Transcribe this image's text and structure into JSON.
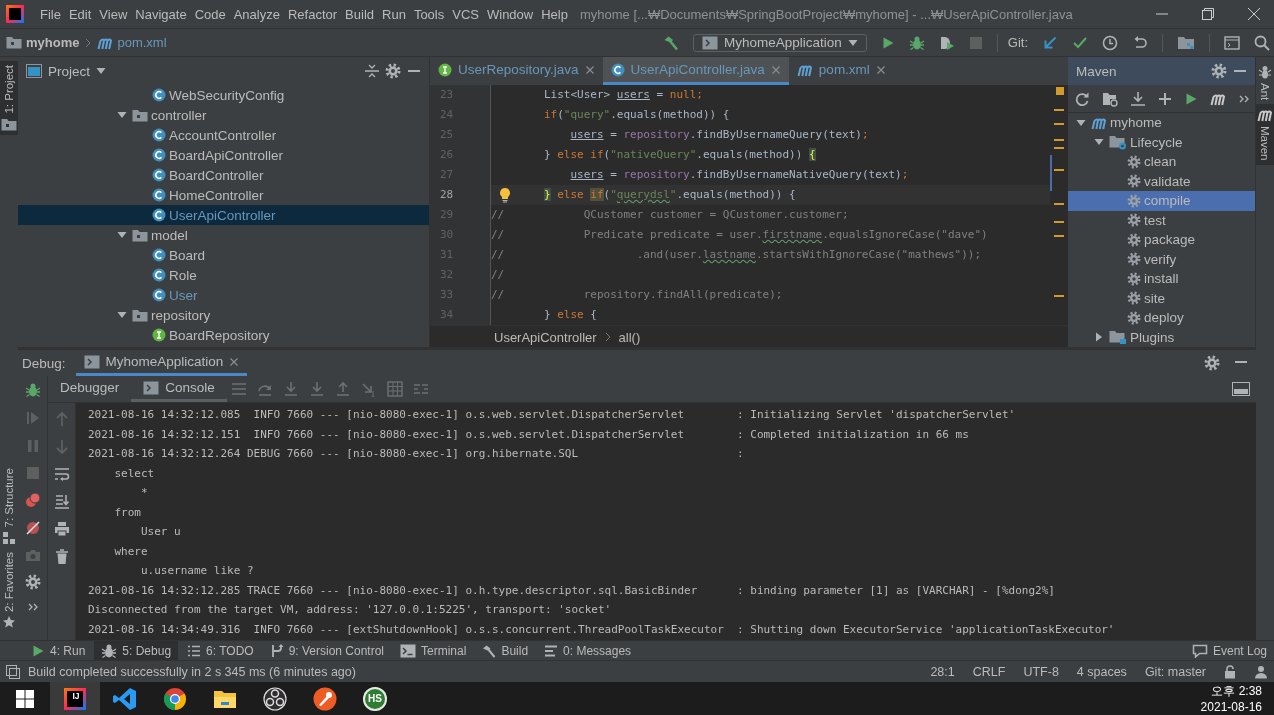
{
  "menu_bar": {
    "items": [
      "File",
      "Edit",
      "View",
      "Navigate",
      "Code",
      "Analyze",
      "Refactor",
      "Build",
      "Run",
      "Tools",
      "VCS",
      "Window",
      "Help"
    ],
    "title": "myhome [...₩Documents₩SpringBootProject₩myhome] - ...₩UserApiController.java"
  },
  "nav_bar": {
    "breadcrumbs": [
      {
        "label": "myhome",
        "kind": "project"
      },
      {
        "label": "pom.xml",
        "kind": "maven"
      }
    ],
    "run_configuration": "MyhomeApplication",
    "vcs_label": "Git:"
  },
  "left_strip": [
    {
      "label": "1: Project",
      "kind": "project",
      "selected": true
    },
    {
      "label": "7: Structure",
      "kind": "structure",
      "selected": false
    },
    {
      "label": "2: Favorites",
      "kind": "favorites",
      "selected": false
    }
  ],
  "right_strip": [
    {
      "label": "Ant",
      "kind": "ant",
      "selected": false
    },
    {
      "label": "Maven",
      "kind": "maven",
      "selected": true
    }
  ],
  "project": {
    "title": "Project",
    "continued": [
      {
        "kind": "class",
        "label": "WebSecurityConfig",
        "modified": false,
        "selected": false
      }
    ],
    "tree": [
      {
        "kind": "folder",
        "label": "controller",
        "expanded": true,
        "selected": false,
        "children": [
          {
            "kind": "class",
            "label": "AccountController",
            "modified": false,
            "selected": false
          },
          {
            "kind": "class",
            "label": "BoardApiController",
            "modified": false,
            "selected": false
          },
          {
            "kind": "class",
            "label": "BoardController",
            "modified": false,
            "selected": false
          },
          {
            "kind": "class",
            "label": "HomeController",
            "modified": false,
            "selected": false
          },
          {
            "kind": "class",
            "label": "UserApiController",
            "modified": true,
            "selected": true
          }
        ]
      },
      {
        "kind": "folder",
        "label": "model",
        "expanded": true,
        "selected": false,
        "children": [
          {
            "kind": "class",
            "label": "Board",
            "modified": false,
            "selected": false
          },
          {
            "kind": "class",
            "label": "Role",
            "modified": false,
            "selected": false
          },
          {
            "kind": "class",
            "label": "User",
            "modified": true,
            "selected": false
          }
        ]
      },
      {
        "kind": "folder",
        "label": "repository",
        "expanded": true,
        "selected": false,
        "children": [
          {
            "kind": "interface",
            "label": "BoardRepository",
            "modified": false,
            "selected": false
          }
        ]
      }
    ]
  },
  "editor": {
    "tabs": [
      {
        "label": "UserRepository.java",
        "kind": "interface",
        "selected": false
      },
      {
        "label": "UserApiController.java",
        "kind": "class",
        "selected": true
      },
      {
        "label": "pom.xml",
        "kind": "maven",
        "selected": false
      }
    ],
    "lines": [
      {
        "number": "23",
        "current": false,
        "segments": [
          {
            "text": "        List<User> ",
            "kind": "plain"
          },
          {
            "text": "users",
            "kind": "local"
          },
          {
            "text": " = ",
            "kind": "plain"
          },
          {
            "text": "null",
            "kind": "keyword"
          },
          {
            "text": ";",
            "kind": "keyword"
          }
        ]
      },
      {
        "number": "24",
        "current": false,
        "segments": [
          {
            "text": "        if",
            "kind": "keyword"
          },
          {
            "text": "(",
            "kind": "plain"
          },
          {
            "text": "\"query\"",
            "kind": "string"
          },
          {
            "text": ".equals(method)) {",
            "kind": "plain"
          }
        ]
      },
      {
        "number": "25",
        "current": false,
        "segments": [
          {
            "text": "            users",
            "kind": "local"
          },
          {
            "text": " = ",
            "kind": "plain"
          },
          {
            "text": "repository",
            "kind": "field"
          },
          {
            "text": ".findByUsernameQuery(text)",
            "kind": "plain"
          },
          {
            "text": ";",
            "kind": "keyword"
          }
        ]
      },
      {
        "number": "26",
        "current": false,
        "segments": [
          {
            "text": "        } ",
            "kind": "plain"
          },
          {
            "text": "else if",
            "kind": "keyword"
          },
          {
            "text": "(",
            "kind": "plain"
          },
          {
            "text": "\"nativeQuery\"",
            "kind": "string"
          },
          {
            "text": ".equals(method)) ",
            "kind": "plain"
          },
          {
            "text": "{",
            "kind": "match"
          }
        ]
      },
      {
        "number": "27",
        "current": false,
        "segments": [
          {
            "text": "            users",
            "kind": "local"
          },
          {
            "text": " = ",
            "kind": "plain"
          },
          {
            "text": "repository",
            "kind": "field"
          },
          {
            "text": ".findByUsernameNativeQuery(text)",
            "kind": "plain"
          },
          {
            "text": ";",
            "kind": "keyword"
          }
        ]
      },
      {
        "number": "28",
        "current": true,
        "segments": [
          {
            "text": "        }",
            "kind": "match"
          },
          {
            "text": " else ",
            "kind": "keyword"
          },
          {
            "text": "if",
            "kind": "keyword-hl"
          },
          {
            "text": "(",
            "kind": "plain"
          },
          {
            "text": "\"",
            "kind": "string"
          },
          {
            "text": "querydsl",
            "kind": "string-typo"
          },
          {
            "text": "\"",
            "kind": "string"
          },
          {
            "text": ".equals(method)) {",
            "kind": "plain"
          }
        ]
      },
      {
        "number": "29",
        "current": false,
        "segments": [
          {
            "text": "//            QCustomer customer = QCustomer.customer;",
            "kind": "comment"
          }
        ]
      },
      {
        "number": "30",
        "current": false,
        "segments": [
          {
            "text": "//            Predicate predicate = user.",
            "kind": "comment"
          },
          {
            "text": "firstname",
            "kind": "comment-typo"
          },
          {
            "text": ".equalsIgnoreCase(\"dave\")",
            "kind": "comment"
          }
        ]
      },
      {
        "number": "31",
        "current": false,
        "segments": [
          {
            "text": "//                    .and(user.",
            "kind": "comment"
          },
          {
            "text": "lastname",
            "kind": "comment-typo"
          },
          {
            "text": ".startsWithIgnoreCase(\"mathews\"));",
            "kind": "comment"
          }
        ]
      },
      {
        "number": "32",
        "current": false,
        "segments": [
          {
            "text": "//",
            "kind": "comment"
          }
        ]
      },
      {
        "number": "33",
        "current": false,
        "segments": [
          {
            "text": "//            repository.findAll(predicate);",
            "kind": "comment"
          }
        ]
      },
      {
        "number": "34",
        "current": false,
        "segments": [
          {
            "text": "        } ",
            "kind": "plain"
          },
          {
            "text": "else",
            "kind": "keyword"
          },
          {
            "text": " {",
            "kind": "plain"
          }
        ]
      }
    ],
    "breadcrumbs": [
      "UserApiController",
      "all()"
    ]
  },
  "maven": {
    "title": "Maven",
    "tree": [
      {
        "kind": "project",
        "label": "myhome",
        "expanded": true,
        "selected": false,
        "children": [
          {
            "kind": "lifecycle",
            "label": "Lifecycle",
            "expanded": true,
            "selected": false,
            "children": [
              {
                "kind": "goal",
                "label": "clean",
                "selected": false
              },
              {
                "kind": "goal",
                "label": "validate",
                "selected": false
              },
              {
                "kind": "goal",
                "label": "compile",
                "selected": true
              },
              {
                "kind": "goal",
                "label": "test",
                "selected": false
              },
              {
                "kind": "goal",
                "label": "package",
                "selected": false
              },
              {
                "kind": "goal",
                "label": "verify",
                "selected": false
              },
              {
                "kind": "goal",
                "label": "install",
                "selected": false
              },
              {
                "kind": "goal",
                "label": "site",
                "selected": false
              },
              {
                "kind": "goal",
                "label": "deploy",
                "selected": false
              }
            ]
          },
          {
            "kind": "plugins",
            "label": "Plugins",
            "expanded": false,
            "selected": false
          }
        ]
      }
    ]
  },
  "debug": {
    "label": "Debug:",
    "session": "MyhomeApplication",
    "tabs": [
      {
        "label": "Debugger",
        "kind": "debugger",
        "selected": false
      },
      {
        "label": "Console",
        "kind": "console",
        "selected": true
      }
    ],
    "console": [
      "2021-08-16 14:32:12.085  INFO 7660 --- [nio-8080-exec-1] o.s.web.servlet.DispatcherServlet        : Initializing Servlet 'dispatcherServlet'",
      "2021-08-16 14:32:12.151  INFO 7660 --- [nio-8080-exec-1] o.s.web.servlet.DispatcherServlet        : Completed initialization in 66 ms",
      "2021-08-16 14:32:12.264 DEBUG 7660 --- [nio-8080-exec-1] org.hibernate.SQL                        :",
      "    select",
      "        *",
      "    from",
      "        User u",
      "    where",
      "        u.username like ?",
      "2021-08-16 14:32:12.285 TRACE 7660 --- [nio-8080-exec-1] o.h.type.descriptor.sql.BasicBinder      : binding parameter [1] as [VARCHAR] - [%dong2%]",
      "Disconnected from the target VM, address: '127.0.0.1:5225', transport: 'socket'",
      "2021-08-16 14:34:49.316  INFO 7660 --- [extShutdownHook] o.s.s.concurrent.ThreadPoolTaskExecutor  : Shutting down ExecutorService 'applicationTaskExecutor'"
    ]
  },
  "tool_tabs": [
    {
      "label": "4: Run",
      "kind": "run",
      "selected": false
    },
    {
      "label": "5: Debug",
      "kind": "debug",
      "selected": true
    },
    {
      "label": "6: TODO",
      "kind": "todo",
      "selected": false
    },
    {
      "label": "9: Version Control",
      "kind": "vcs",
      "selected": false
    },
    {
      "label": "Terminal",
      "kind": "terminal",
      "selected": false
    },
    {
      "label": "Build",
      "kind": "build",
      "selected": false
    },
    {
      "label": "0: Messages",
      "kind": "messages",
      "selected": false
    }
  ],
  "event_log": "Event Log",
  "status_bar": {
    "message": "Build completed successfully in 2 s 345 ms (6 minutes ago)",
    "items": [
      "28:1",
      "CRLF",
      "UTF-8",
      "4 spaces",
      "Git: master"
    ]
  },
  "taskbar": {
    "apps": [
      {
        "kind": "intellij",
        "label": "IJ",
        "selected": true
      },
      {
        "kind": "vscode",
        "selected": false
      },
      {
        "kind": "chrome",
        "selected": false
      },
      {
        "kind": "explorer",
        "selected": false
      },
      {
        "kind": "obs",
        "selected": false
      },
      {
        "kind": "postman",
        "selected": false
      },
      {
        "kind": "hs",
        "label": "HS",
        "selected": false
      }
    ],
    "time": "오후 2:38",
    "date": "2021-08-16"
  }
}
